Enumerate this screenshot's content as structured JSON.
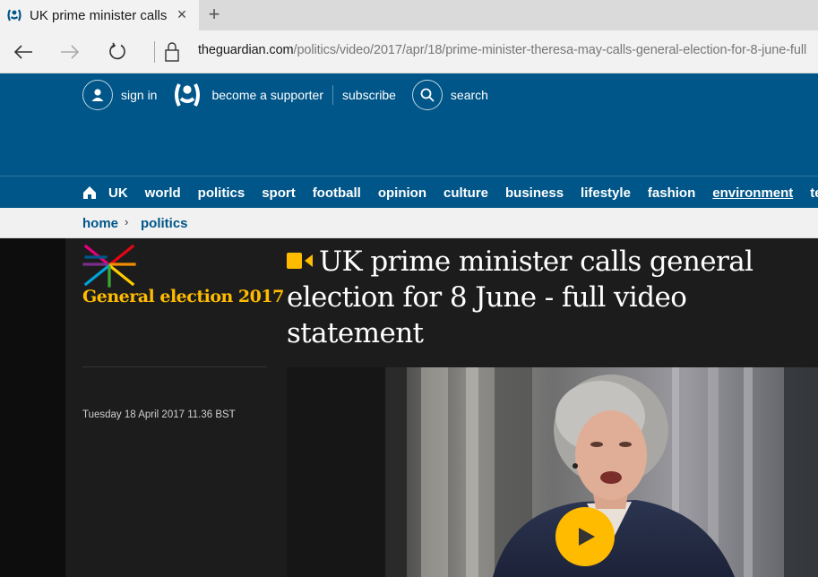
{
  "browser": {
    "tab_title": "UK prime minister calls",
    "tab_close": "×",
    "new_tab": "+",
    "url_host": "theguardian.com",
    "url_path": "/politics/video/2017/apr/18/prime-minister-theresa-may-calls-general-election-for-8-june-full"
  },
  "header": {
    "sign_in": "sign in",
    "become_supporter": "become a supporter",
    "subscribe": "subscribe",
    "search": "search"
  },
  "nav": {
    "items": [
      "UK",
      "world",
      "politics",
      "sport",
      "football",
      "opinion",
      "culture",
      "business",
      "lifestyle",
      "fashion",
      "environment",
      "tech"
    ],
    "underlined": "environment",
    "active": "opinion"
  },
  "breadcrumb": {
    "items": [
      "home",
      "politics"
    ],
    "separator": "›"
  },
  "article": {
    "series": "General election 2017",
    "headline": "UK prime minister calls general election for 8 June - full video statement",
    "date": "Tuesday 18 April 2017 11.36 BST"
  },
  "colors": {
    "brand_blue": "#005689",
    "accent_yellow": "#ffbb00",
    "dark_bg": "#121212"
  }
}
